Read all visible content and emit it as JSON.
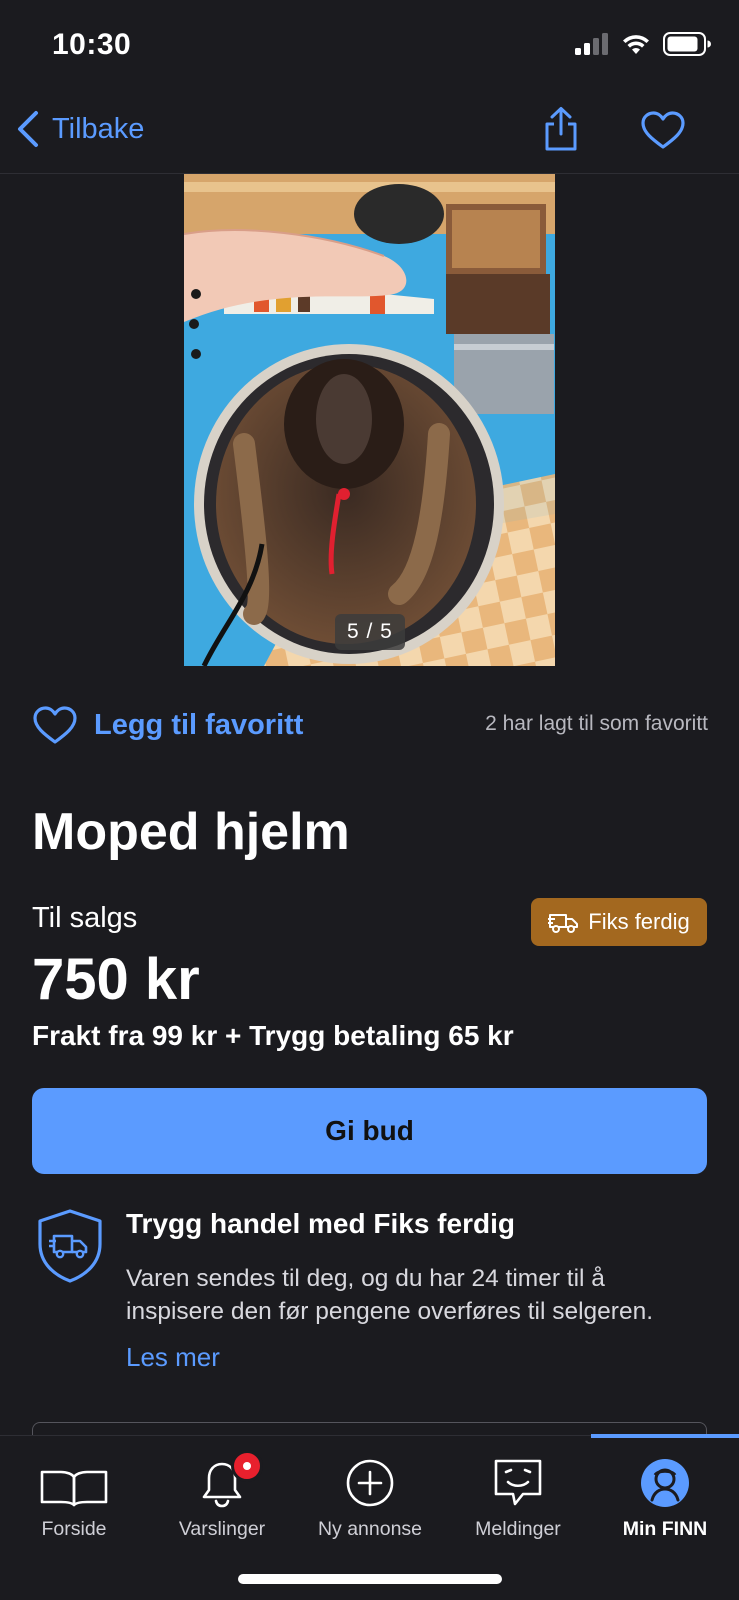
{
  "status_bar": {
    "time": "10:30"
  },
  "nav": {
    "back_label": "Tilbake"
  },
  "gallery": {
    "counter": "5 / 5"
  },
  "favorite": {
    "label": "Legg til favoritt",
    "count_text": "2 har lagt til som favoritt"
  },
  "listing": {
    "title": "Moped hjelm",
    "sale_label": "Til salgs",
    "badge": "Fiks ferdig",
    "price": "750 kr",
    "shipping": "Frakt fra 99 kr + Trygg betaling 65 kr"
  },
  "bid_button": "Gi bud",
  "trust": {
    "title": "Trygg handel med Fiks ferdig",
    "body": "Varen sendes til deg, og du har 24 timer til å inspisere den før pengene overføres til selgeren.",
    "read_more": "Les mer"
  },
  "tabs": [
    {
      "label": "Forside",
      "icon": "book-icon"
    },
    {
      "label": "Varslinger",
      "icon": "bell-icon"
    },
    {
      "label": "Ny annonse",
      "icon": "plus-circle-icon"
    },
    {
      "label": "Meldinger",
      "icon": "chat-icon"
    },
    {
      "label": "Min FINN",
      "icon": "avatar-icon",
      "active": true
    }
  ],
  "colors": {
    "accent": "#5b9bff",
    "badge": "#a3681f",
    "background": "#1b1b1f",
    "notification": "#e8202d"
  }
}
